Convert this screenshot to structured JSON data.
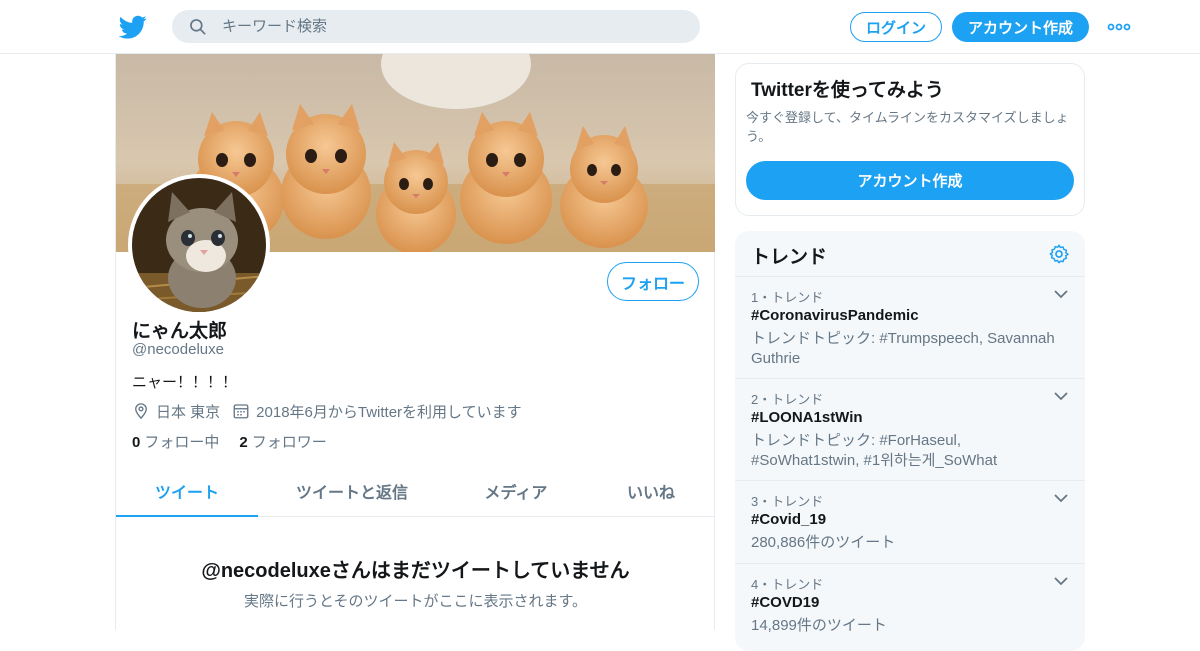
{
  "header": {
    "search_placeholder": "キーワード検索",
    "login_label": "ログイン",
    "signup_label": "アカウント作成"
  },
  "profile": {
    "follow_label": "フォロー",
    "name": "にゃん太郎",
    "handle": "@necodeluxe",
    "bio": "ニャー！！！！",
    "location": "日本 東京",
    "joined": "2018年6月からTwitterを利用しています",
    "following_count": "0",
    "following_label": "フォロー中",
    "followers_count": "2",
    "followers_label": "フォロワー",
    "tabs": [
      {
        "label": "ツイート",
        "active": true
      },
      {
        "label": "ツイートと返信",
        "active": false
      },
      {
        "label": "メディア",
        "active": false
      },
      {
        "label": "いいね",
        "active": false
      }
    ],
    "empty_title": "@necodeluxeさんはまだツイートしていません",
    "empty_sub": "実際に行うとそのツイートがここに表示されます。"
  },
  "sidebar": {
    "try_title": "Twitterを使ってみよう",
    "try_text": "今すぐ登録して、タイムラインをカスタマイズしましょう。",
    "try_button": "アカウント作成",
    "trends_title": "トレンド",
    "trends": [
      {
        "rank": "1・トレンド",
        "tag": "#CoronavirusPandemic",
        "desc": "トレンドトピック: #Trumpspeech, Savannah Guthrie"
      },
      {
        "rank": "2・トレンド",
        "tag": "#LOONA1stWin",
        "desc": "トレンドトピック: #ForHaseul, #SoWhat1stwin, #1위하는게_SoWhat"
      },
      {
        "rank": "3・トレンド",
        "tag": "#Covid_19",
        "desc": "280,886件のツイート"
      },
      {
        "rank": "4・トレンド",
        "tag": "#COVD19",
        "desc": "14,899件のツイート"
      }
    ]
  },
  "colors": {
    "accent": "#1da1f2",
    "text": "#14171a",
    "muted": "#657786",
    "border": "#e6ecf0",
    "panel": "#f5f8fa"
  }
}
